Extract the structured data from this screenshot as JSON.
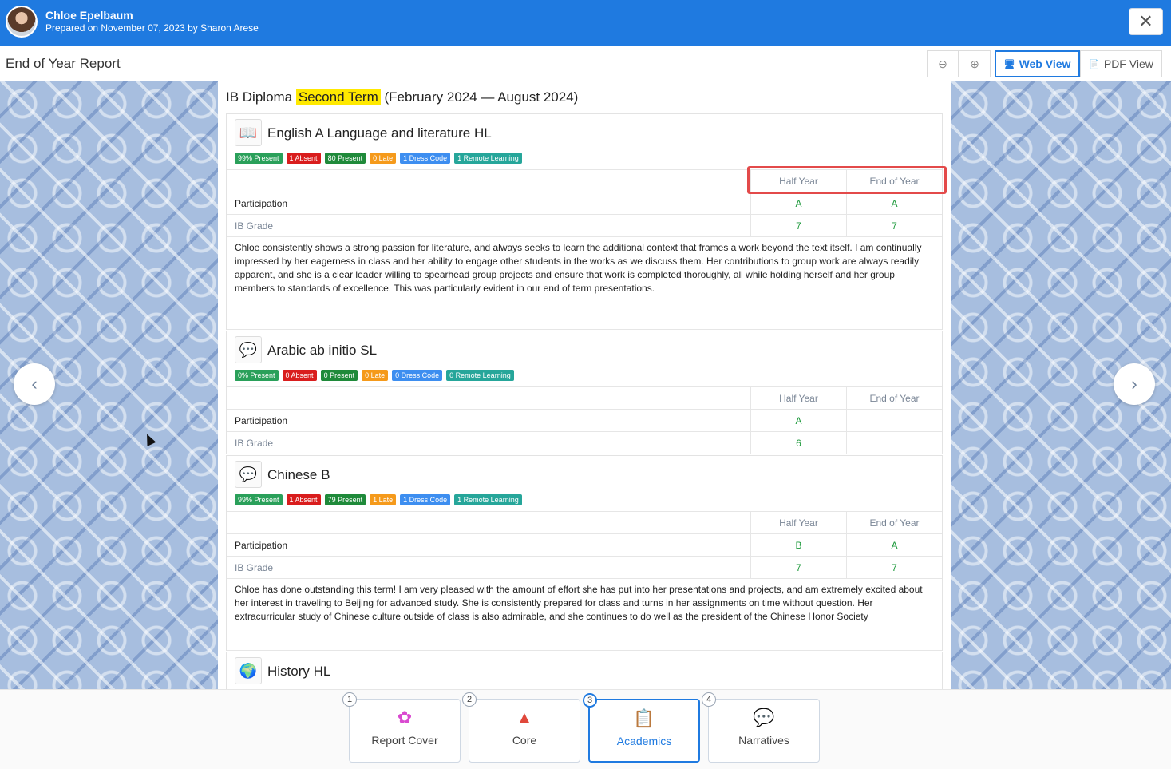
{
  "header": {
    "student_name": "Chloe Epelbaum",
    "prepared": "Prepared on November 07, 2023 by Sharon Arese",
    "close_icon": "✕"
  },
  "toolbar": {
    "report_title": "End of Year Report",
    "zoom_out_icon": "⊖",
    "zoom_in_icon": "⊕",
    "web_view_label": "Web View",
    "pdf_view_label": "PDF View",
    "web_view_icon": "🖥",
    "pdf_view_icon": "📄"
  },
  "nav": {
    "prev_icon": "‹",
    "next_icon": "›"
  },
  "term": {
    "prefix": "IB Diploma",
    "highlight": "Second Term",
    "suffix": "(February 2024 — August 2024)"
  },
  "table_headers": {
    "half": "Half Year",
    "end": "End of Year"
  },
  "subjects": [
    {
      "name": "English A Language and literature HL",
      "icon": "📖",
      "badges": [
        "99% Present",
        "1 Absent",
        "80 Present",
        "0 Late",
        "1 Dress Code",
        "1 Remote Learning"
      ],
      "participation_label": "Participation",
      "participation": [
        "A",
        "A"
      ],
      "grade_label": "IB Grade",
      "grade": [
        "7",
        "7"
      ],
      "comment": "Chloe consistently shows a strong passion for literature, and always seeks to learn the additional context that frames a work beyond the text itself. I am continually impressed by her eagerness in class and her ability to engage other students in the works as we discuss them. Her contributions to group work are always readily apparent, and she is a clear leader willing to spearhead group projects and ensure that work is completed thoroughly, all while holding herself and her group members to standards of excellence. This was particularly evident in our end of term presentations."
    },
    {
      "name": "Arabic ab initio SL",
      "icon": "💬",
      "badges": [
        "0% Present",
        "0 Absent",
        "0 Present",
        "0 Late",
        "0 Dress Code",
        "0 Remote Learning"
      ],
      "participation_label": "Participation",
      "participation": [
        "A",
        ""
      ],
      "grade_label": "IB Grade",
      "grade": [
        "6",
        ""
      ]
    },
    {
      "name": "Chinese B",
      "icon": "💬",
      "badges": [
        "99% Present",
        "1 Absent",
        "79 Present",
        "1 Late",
        "1 Dress Code",
        "1 Remote Learning"
      ],
      "participation_label": "Participation",
      "participation": [
        "B",
        "A"
      ],
      "grade_label": "IB Grade",
      "grade": [
        "7",
        "7"
      ],
      "comment": "Chloe has done outstanding this term! I am very pleased with the amount of effort she has put into her presentations and projects, and am extremely excited about her interest in traveling to Beijing for advanced study. She is consistently prepared for class and turns in her assignments on time without question. Her extracurricular study of Chinese culture outside of class is also admirable, and she continues to do well as the president of the Chinese Honor Society"
    },
    {
      "name": "History HL",
      "icon": "🌍"
    }
  ],
  "tabs": [
    {
      "num": "1",
      "label": "Report Cover",
      "icon": "✿"
    },
    {
      "num": "2",
      "label": "Core",
      "icon": "▲"
    },
    {
      "num": "3",
      "label": "Academics",
      "icon": "📋"
    },
    {
      "num": "4",
      "label": "Narratives",
      "icon": "💬"
    }
  ],
  "colors": {
    "primary": "#1f7ae0",
    "highlight": "#ffe900",
    "annotation": "#e34a4a"
  }
}
